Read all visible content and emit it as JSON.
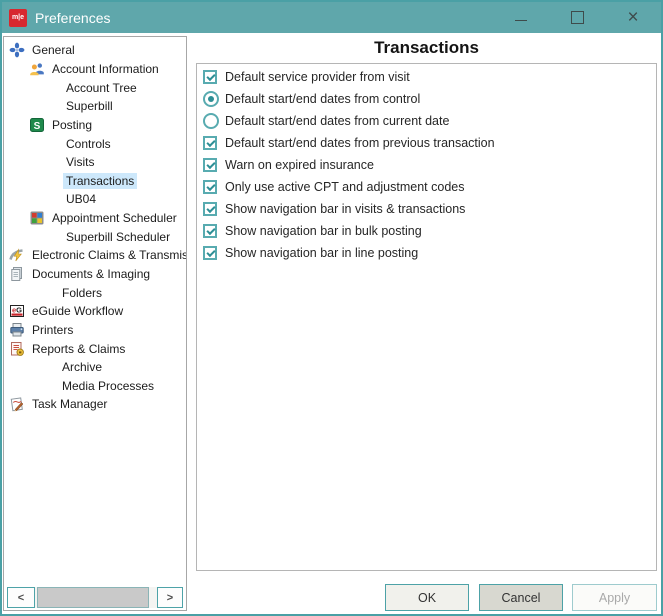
{
  "window": {
    "title": "Preferences",
    "logo_text": "m|e"
  },
  "icons": {
    "minimize": "–",
    "maximize": "□",
    "close": "×",
    "scroll_left": "<",
    "scroll_right": ">"
  },
  "sidebar": {
    "items": [
      {
        "label": "General",
        "icon": "general-icon",
        "level": 0
      },
      {
        "label": "Account Information",
        "icon": "account-information-icon",
        "level": 1
      },
      {
        "label": "Account Tree",
        "level": 2
      },
      {
        "label": "Superbill",
        "level": 2
      },
      {
        "label": "Posting",
        "icon": "posting-icon",
        "level": 1
      },
      {
        "label": "Controls",
        "level": 2
      },
      {
        "label": "Visits",
        "level": 2
      },
      {
        "label": "Transactions",
        "level": 2,
        "selected": true
      },
      {
        "label": "UB04",
        "level": 2
      },
      {
        "label": "Appointment Scheduler",
        "icon": "appointment-scheduler-icon",
        "level": 1
      },
      {
        "label": "Superbill Scheduler",
        "level": 2
      },
      {
        "label": "Electronic Claims & Transmis",
        "icon": "electronic-claims-icon",
        "level": 0
      },
      {
        "label": "Documents & Imaging",
        "icon": "documents-imaging-icon",
        "level": 0
      },
      {
        "label": "Folders",
        "level": 2
      },
      {
        "label": "eGuide Workflow",
        "icon": "eguide-workflow-icon",
        "level": 0
      },
      {
        "label": "Printers",
        "icon": "printers-icon",
        "level": 0
      },
      {
        "label": "Reports & Claims",
        "icon": "reports-claims-icon",
        "level": 0
      },
      {
        "label": "Archive",
        "level": 2
      },
      {
        "label": "Media Processes",
        "level": 2
      },
      {
        "label": "Task Manager",
        "icon": "task-manager-icon",
        "level": 0
      }
    ]
  },
  "panel": {
    "heading": "Transactions",
    "options": [
      {
        "type": "checkbox",
        "checked": true,
        "label": "Default service provider from visit"
      },
      {
        "type": "radio",
        "checked": true,
        "label": "Default start/end dates from control"
      },
      {
        "type": "radio",
        "checked": false,
        "label": "Default start/end dates from current date"
      },
      {
        "type": "checkbox",
        "checked": true,
        "label": "Default start/end dates from previous transaction"
      },
      {
        "type": "checkbox",
        "checked": true,
        "label": "Warn on expired insurance"
      },
      {
        "type": "checkbox",
        "checked": true,
        "label": "Only use active CPT and adjustment codes"
      },
      {
        "type": "checkbox",
        "checked": true,
        "label": "Show navigation bar in visits & transactions"
      },
      {
        "type": "checkbox",
        "checked": true,
        "label": "Show navigation bar in bulk posting"
      },
      {
        "type": "checkbox",
        "checked": true,
        "label": "Show navigation bar in line posting"
      }
    ]
  },
  "footer": {
    "ok": "OK",
    "cancel": "Cancel",
    "apply": "Apply"
  },
  "colors": {
    "titlebar": "#5fa7ab",
    "accent_teal": "#4aa0a5",
    "control_teal": "#58abb0",
    "selected_item_bg": "#cde8fb",
    "logo_red": "#d7282f"
  }
}
